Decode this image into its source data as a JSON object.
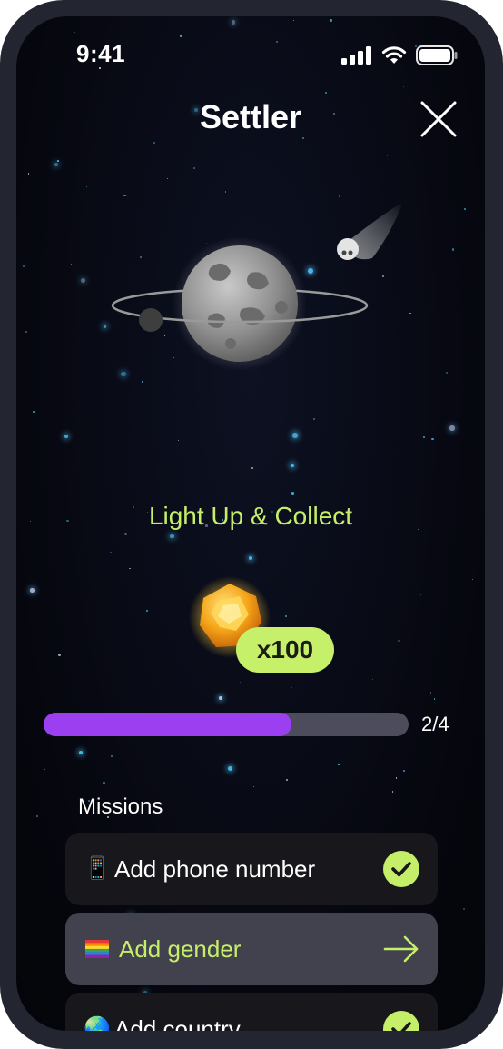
{
  "status_bar": {
    "time": "9:41",
    "icons": [
      "signal-icon",
      "wifi-icon",
      "battery-icon"
    ]
  },
  "header": {
    "title": "Settler",
    "close_icon": "close-icon"
  },
  "reward": {
    "title": "Light Up & Collect",
    "multiplier": "x100",
    "gem_icon": "gem-icon"
  },
  "progress": {
    "completed": 2,
    "total": 4,
    "fraction": 0.68,
    "label": "2/4"
  },
  "missions": {
    "title": "Missions",
    "items": [
      {
        "emoji": "📱",
        "label": "Add phone number",
        "status": "done",
        "status_icon": "check-icon"
      },
      {
        "emoji": "🏳️‍🌈",
        "label": "Add gender",
        "status": "todo",
        "status_icon": "arrow-right-icon"
      },
      {
        "emoji": "🌏",
        "label": "Add country",
        "status": "done",
        "status_icon": "check-icon"
      }
    ]
  },
  "colors": {
    "accent_green": "#c6ef69",
    "progress_purple": "#9b3ff0",
    "track_gray": "#4c4c5c",
    "background": "#06070f"
  }
}
